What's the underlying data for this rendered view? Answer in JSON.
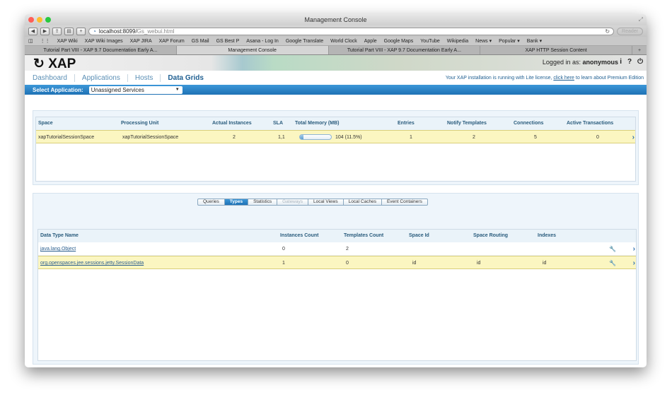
{
  "window": {
    "title": "Management Console"
  },
  "browser": {
    "url_host": "localhost:8099/",
    "url_path": "Gs_webui.html",
    "reader_label": "Reader",
    "bookmarks": [
      "XAP Wiki",
      "XAP Wiki Images",
      "XAP JIRA",
      "XAP Forum",
      "GS Mail",
      "GS Best P",
      "Asana - Log In",
      "Google Translate",
      "World Clock",
      "Apple",
      "Google Maps",
      "YouTube",
      "Wikipedia",
      "News ▾",
      "Popular ▾",
      "Bank ▾"
    ],
    "tabs": [
      {
        "label": "Tutorial Part VIII - XAP 9.7 Documentation Early A..."
      },
      {
        "label": "Management Console"
      },
      {
        "label": "Tutorial Part VIII - XAP 9.7 Documentation Early A..."
      },
      {
        "label": "XAP HTTP Session Content"
      }
    ]
  },
  "app": {
    "logo": "XAP",
    "logged_prefix": "Logged in as:",
    "user": "anonymous",
    "nav": [
      "Dashboard",
      "Applications",
      "Hosts",
      "Data Grids"
    ],
    "license_pre": "Your XAP installation is running with Lite license,",
    "license_link": "click here",
    "license_post": "to learn about Premium Edition",
    "select_label": "Select Application:",
    "select_value": "Unassigned Services"
  },
  "spaces": {
    "headers": [
      "Space",
      "Processing Unit",
      "Actual Instances",
      "SLA",
      "Total Memory (MB)",
      "Entries",
      "Notify Templates",
      "Connections",
      "Active Transactions"
    ],
    "rows": [
      {
        "space": "xapTutorialSessionSpace",
        "pu": "xapTutorialSessionSpace",
        "instances": "2",
        "sla": "1,1",
        "memory": "104 (11.5%)",
        "memory_pct": 11.5,
        "entries": "1",
        "notify": "2",
        "connections": "5",
        "transactions": "0"
      }
    ]
  },
  "subtabs": [
    "Queries",
    "Types",
    "Statistics",
    "Gateways",
    "Local Views",
    "Local Caches",
    "Event Containers"
  ],
  "types": {
    "headers": [
      "Data Type Name",
      "Instances Count",
      "Templates Count",
      "Space Id",
      "Space Routing",
      "Indexes"
    ],
    "rows": [
      {
        "name": "java.lang.Object",
        "instances": "0",
        "templates": "2",
        "space_id": "",
        "routing": "",
        "indexes": ""
      },
      {
        "name": "org.openspaces.jee.sessions.jetty.SessionData",
        "instances": "1",
        "templates": "0",
        "space_id": "id",
        "routing": "id",
        "indexes": "id"
      }
    ]
  },
  "colors": {
    "accent": "#1f72b5",
    "selected_row": "#fbf6c1",
    "link": "#2b5f8f"
  }
}
